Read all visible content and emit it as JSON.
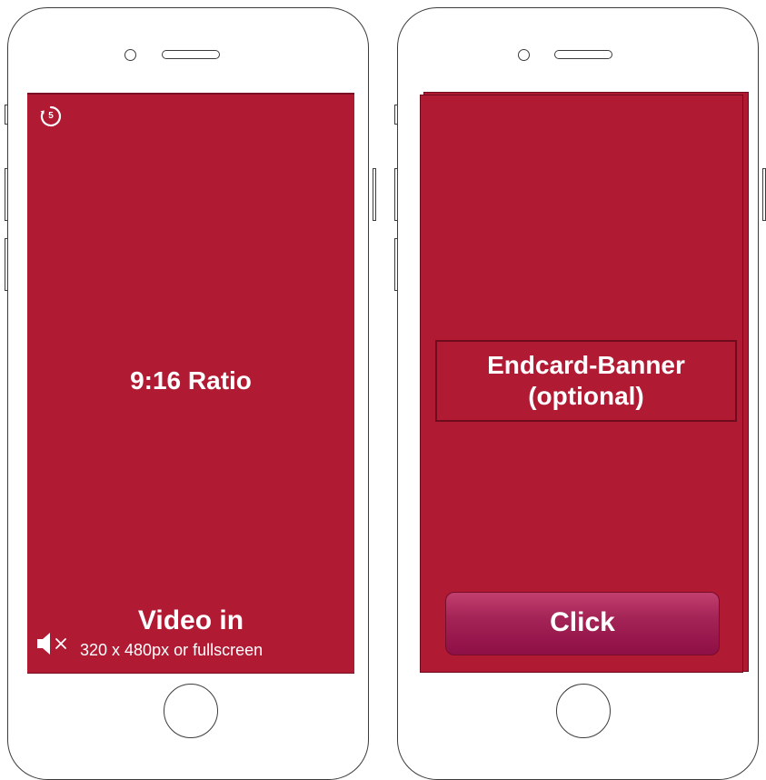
{
  "left_phone": {
    "ratio_label": "9:16 Ratio",
    "video_title": "Video in",
    "video_subtitle": "320 x 480px or fullscreen",
    "countdown_value": "5",
    "icons": [
      "countdown-timer-icon",
      "mute-icon"
    ]
  },
  "right_phone": {
    "banner_line1": "Endcard-Banner",
    "banner_line2": "(optional)",
    "cta_label": "Click"
  },
  "colors": {
    "screen": "#b01a33",
    "screen_border": "#6e0b1d",
    "button_top": "#c2406e",
    "button_bottom": "#8e0f45",
    "outline": "#3c3c3c"
  }
}
